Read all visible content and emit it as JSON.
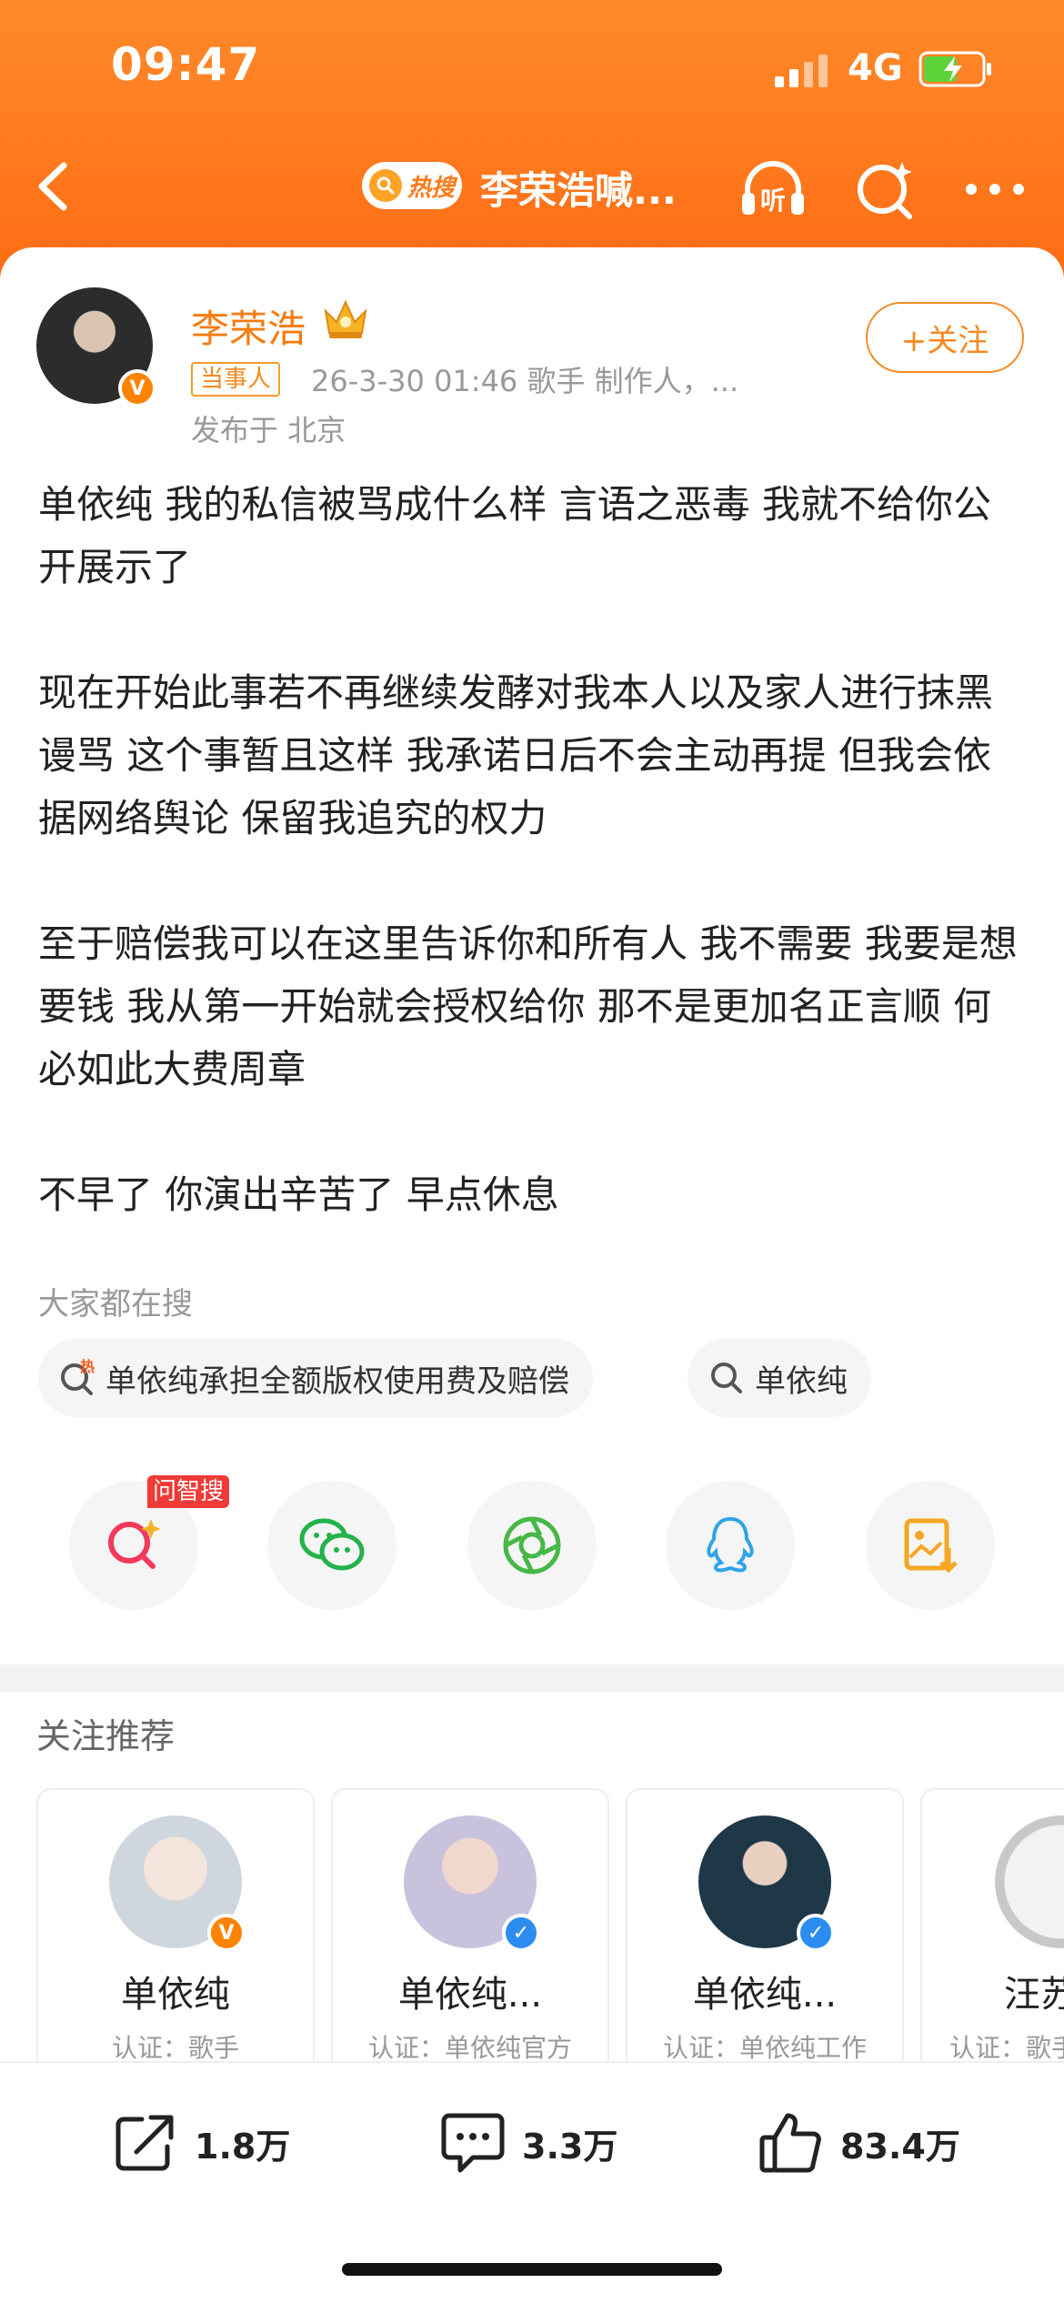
{
  "status_bar": {
    "time": "09:47",
    "network": "4G"
  },
  "nav": {
    "hot_label": "热搜",
    "title": "李荣浩喊..."
  },
  "post": {
    "author": "李荣浩",
    "tag": "当事人",
    "meta": "26-3-30 01:46  歌手 制作人，...",
    "location": "发布于 北京",
    "follow_label": "+关注",
    "paragraphs": [
      "单依纯 我的私信被骂成什么样 言语之恶毒 我就不给你公开展示了",
      "现在开始此事若不再继续发酵对我本人以及家人进行抹黑 谩骂 这个事暂且这样 我承诺日后不会主动再提 但我会依据网络舆论 保留我追究的权力",
      "至于赔偿我可以在这里告诉你和所有人 我不需要 我要是想要钱 我从第一开始就会授权给你 那不是更加名正言顺 何必如此大费周章",
      "不早了 你演出辛苦了 早点休息"
    ]
  },
  "searches": {
    "label": "大家都在搜",
    "items": [
      "单依纯承担全额版权使用费及赔偿",
      "单依纯"
    ]
  },
  "share": {
    "ask_badge": "问智搜"
  },
  "recommend": {
    "title": "关注推荐",
    "cards": [
      {
        "name": "单依纯",
        "verify": "认证：歌手"
      },
      {
        "name": "单依纯...",
        "verify": "认证：单依纯官方"
      },
      {
        "name": "单依纯...",
        "verify": "认证：单依纯工作"
      },
      {
        "name": "汪苏",
        "verify": "认证：歌手"
      }
    ]
  },
  "actions": {
    "repost": "1.8万",
    "comment": "3.3万",
    "like": "83.4万"
  },
  "colors": {
    "brand": "#ff7a1a",
    "accent": "#f58a23",
    "badge_red": "#f03a35"
  }
}
